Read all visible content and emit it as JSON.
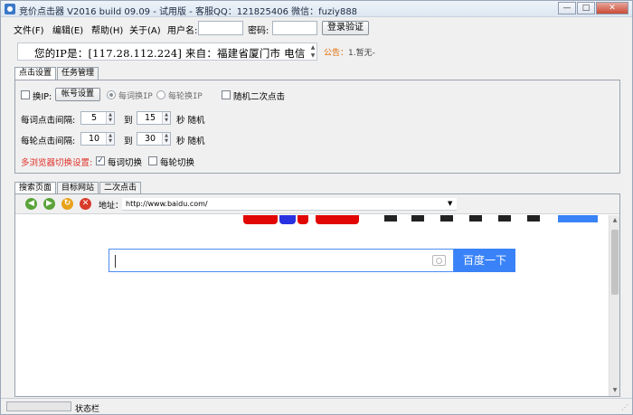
{
  "window": {
    "title": "竞价点击器 V2016 build 09.09 - 试用版 - 客服QQ：121825406 微信：fuziy888",
    "controls": [
      "—",
      "□",
      "✕"
    ]
  },
  "menu": {
    "items": [
      "文件(F)",
      "编辑(E)",
      "帮助(H)",
      "关于(A)"
    ]
  },
  "login": {
    "username_label": "用户名:",
    "username_value": "",
    "password_label": "密码:",
    "password_value": "",
    "login_button": "登录验证"
  },
  "ip_info": {
    "text": "您的IP是：[117.28.112.224] 来自：福建省厦门市 电信"
  },
  "notice": {
    "label": "公告：",
    "text": "1.暂无-"
  },
  "settings_tabs": [
    "点击设置",
    "任务管理"
  ],
  "settings": {
    "change_ip_label": "换IP:",
    "account_settings_button": "帐号设置",
    "per_word_change_ip": "每词换IP",
    "per_round_change_ip": "每轮换IP",
    "random_second_click": "随机二次点击",
    "word_interval_label": "每词点击间隔:",
    "word_interval_from": "5",
    "word_interval_to": "15",
    "to_label": "到",
    "seconds_random": "秒 随机",
    "round_interval_label": "每轮点击间隔:",
    "round_interval_from": "10",
    "round_interval_to": "30",
    "multi_browser_label": "多浏览器切换设置:",
    "per_word_switch": "每词切换",
    "per_round_switch": "每轮切换",
    "per_word_switch_checked": true,
    "per_round_switch_checked": false,
    "change_ip_checked": false,
    "random_second_click_checked": false,
    "selected_radio": "per_word_change_ip"
  },
  "browser_tabs": [
    "搜索页面",
    "目标网站",
    "二次点击"
  ],
  "browser": {
    "address_label": "地址：",
    "address_value": "http://www.baidu.com/",
    "search_button": "百度一下",
    "search_value": "",
    "colors": {
      "accent_blue": "#3a82f7",
      "baidu_red": "#e10601",
      "baidu_blue": "#2932e1"
    }
  },
  "statusbar": {
    "text": "状态栏",
    "progress": 0
  }
}
